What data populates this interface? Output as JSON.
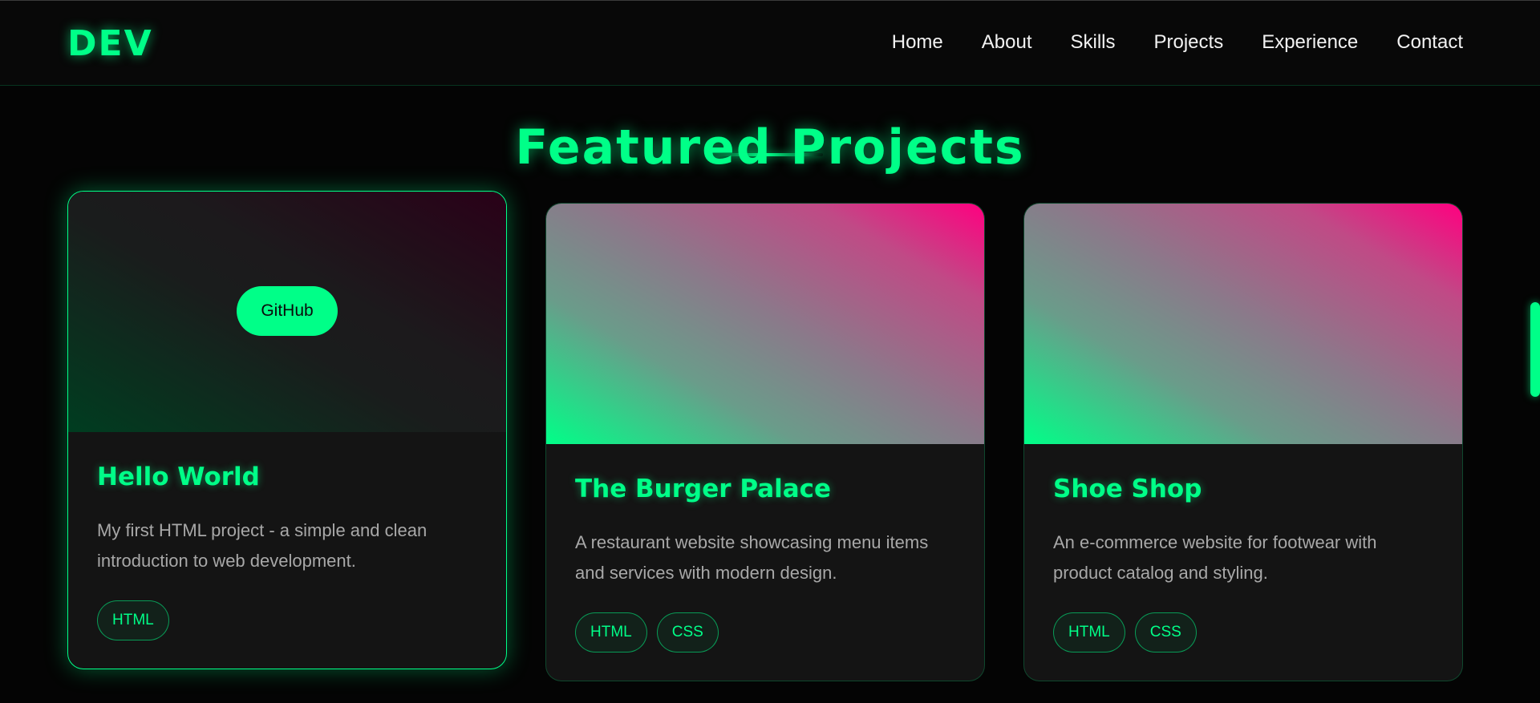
{
  "brand": {
    "logo": "DEV"
  },
  "nav": {
    "items": [
      {
        "label": "Home"
      },
      {
        "label": "About"
      },
      {
        "label": "Skills"
      },
      {
        "label": "Projects"
      },
      {
        "label": "Experience"
      },
      {
        "label": "Contact"
      }
    ]
  },
  "projects": {
    "title": "Featured Projects",
    "cards": [
      {
        "title": "Hello World",
        "description": "My first HTML project - a simple and clean introduction to web development.",
        "tags": [
          "HTML"
        ],
        "hover_button": "GitHub"
      },
      {
        "title": "The Burger Palace",
        "description": "A restaurant website showcasing menu items and services with modern design.",
        "tags": [
          "HTML",
          "CSS"
        ]
      },
      {
        "title": "Shoe Shop",
        "description": "An e-commerce website for footwear with product catalog and styling.",
        "tags": [
          "HTML",
          "CSS"
        ]
      }
    ]
  },
  "colors": {
    "accent": "#00ff88",
    "accent_pink": "#ff0080",
    "background": "#050505",
    "card_background": "#141414"
  }
}
